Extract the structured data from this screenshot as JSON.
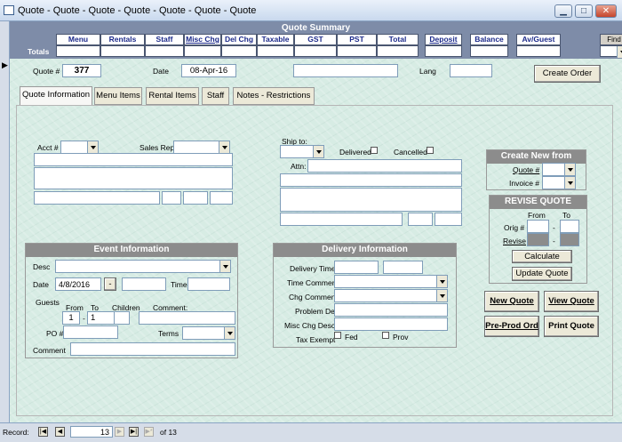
{
  "window": {
    "title": "Quote - Quote - Quote - Quote - Quote - Quote - Quote"
  },
  "summary": {
    "title": "Quote Summary",
    "totals_label": "Totals",
    "columns": [
      "Menu",
      "Rentals",
      "Staff",
      "Misc Chg",
      "Del Chg",
      "Taxable",
      "GST",
      "PST",
      "Total",
      "Deposit",
      "Balance",
      "Av/Guest"
    ],
    "find_quote_label": "Find Quote"
  },
  "record": {
    "quote_label": "Quote #",
    "quote_number": "377",
    "date_label": "Date",
    "date_value": "08-Apr-16",
    "lang_label": "Lang",
    "create_order_label": "Create Order"
  },
  "tabs": [
    "Quote Information",
    "Menu Items",
    "Rental Items",
    "Staff",
    "Notes - Restrictions"
  ],
  "account": {
    "acct_label": "Acct #",
    "sales_rep_label": "Sales Rep"
  },
  "shipto": {
    "ship_to_label": "Ship to:",
    "delivered_label": "Delivered",
    "cancelled_label": "Cancelled",
    "attn_label": "Attn:"
  },
  "create_new": {
    "title": "Create New from",
    "quote_label": "Quote #",
    "invoice_label": "Invoice #"
  },
  "revise": {
    "title": "REVISE QUOTE",
    "from_label": "From",
    "to_label": "To",
    "orig_label": "Orig #",
    "revise_label": "Revise",
    "dash": "-",
    "calculate_label": "Calculate",
    "update_label": "Update Quote"
  },
  "actions": {
    "new_quote": "New Quote",
    "view_quote": "View Quote",
    "pre_prod": "Pre-Prod Ord",
    "print_quote": "Print Quote"
  },
  "event": {
    "title": "Event Information",
    "desc_label": "Desc",
    "date_label": "Date",
    "date_value": "4/8/2016",
    "date_btn": "-",
    "time_label": "Time",
    "guests_label": "Guests",
    "from_label": "From",
    "to_label": "To",
    "children_label": "Children",
    "comment_col_label": "Comment:",
    "from_value": "1",
    "to_value": "1",
    "dash": "-",
    "po_label": "PO #",
    "terms_label": "Terms",
    "comment_label": "Comment"
  },
  "delivery": {
    "title": "Delivery Information",
    "delivery_time": "Delivery Time",
    "time_comment": "Time Comment",
    "chg_comment": "Chg Comment",
    "problem_del": "Problem Del",
    "misc_chg_desc": "Misc Chg Desc",
    "tax_exempt": "Tax Exempt",
    "fed": "Fed",
    "prov": "Prov"
  },
  "status": {
    "record_label": "Record:",
    "current": "13",
    "of_label": "of 13"
  }
}
